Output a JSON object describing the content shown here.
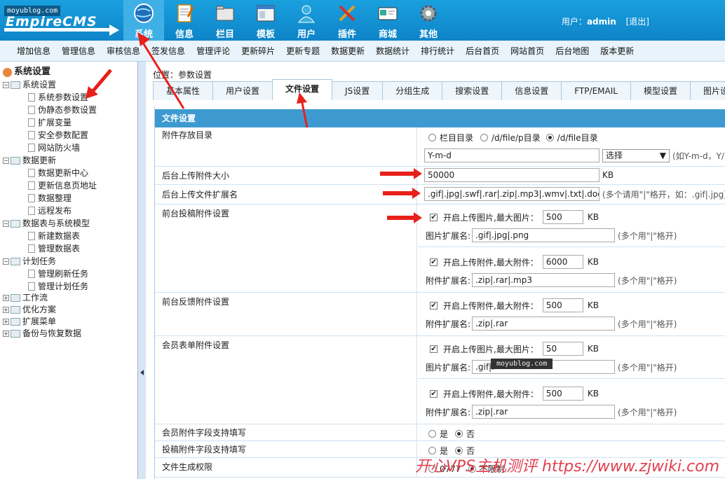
{
  "logo": {
    "site": "moyublog.com",
    "name": "EmpireCMS"
  },
  "nav": [
    {
      "label": "系统",
      "icon": "globe-icon",
      "active": true
    },
    {
      "label": "信息",
      "icon": "document-icon"
    },
    {
      "label": "栏目",
      "icon": "folder-icon"
    },
    {
      "label": "模板",
      "icon": "window-icon"
    },
    {
      "label": "用户",
      "icon": "user-icon"
    },
    {
      "label": "插件",
      "icon": "tools-icon"
    },
    {
      "label": "商城",
      "icon": "card-icon"
    },
    {
      "label": "其他",
      "icon": "gear-icon"
    }
  ],
  "user": {
    "prefix": "用户：",
    "name": "admin",
    "logout": "[退出]"
  },
  "subnav": [
    "增加信息",
    "管理信息",
    "审核信息",
    "签发信息",
    "管理评论",
    "更新碎片",
    "更新专题",
    "数据更新",
    "数据统计",
    "排行统计",
    "后台首页",
    "网站首页",
    "后台地图",
    "版本更新"
  ],
  "tree": {
    "root": "系统设置",
    "g1": "系统设置",
    "g1items": [
      "系统参数设置",
      "伪静态参数设置",
      "扩展变量",
      "安全参数配置",
      "网站防火墙"
    ],
    "g2": "数据更新",
    "g2items": [
      "数据更新中心",
      "更新信息页地址",
      "数据整理",
      "远程发布"
    ],
    "g3": "数据表与系统模型",
    "g3items": [
      "新建数据表",
      "管理数据表"
    ],
    "g4": "计划任务",
    "g4items": [
      "管理刷新任务",
      "管理计划任务"
    ],
    "others": [
      "工作流",
      "优化方案",
      "扩展菜单",
      "备份与恢复数据"
    ]
  },
  "location": "位置：参数设置",
  "tabs": [
    "基本属性",
    "用户设置",
    "文件设置",
    "JS设置",
    "分组生成",
    "搜索设置",
    "信息设置",
    "FTP/EMAIL",
    "模型设置",
    "图片设置"
  ],
  "panel": {
    "title": "文件设置",
    "dir": {
      "label": "附件存放目录",
      "opt1": "栏目目录",
      "opt2": "/d/file/p目录",
      "opt3": "/d/file目录",
      "format": "Y-m-d",
      "select": "选择",
      "hint": "(如Y-m-d，Y/m"
    },
    "size": {
      "label": "后台上传附件大小",
      "value": "50000",
      "unit": "KB"
    },
    "ext": {
      "label": "后台上传文件扩展名",
      "value": ".gif|.jpg|.swf|.rar|.zip|.mp3|.wmv|.txt|.doc|.",
      "hint": "(多个请用\"|\"格开，如：.gif|.jpg)"
    },
    "front": {
      "label": "前台投稿附件设置",
      "img_chk": "开启上传图片,最大图片：",
      "img_max": "500",
      "img_ext_label": "图片扩展名:",
      "img_ext": ".gif|.jpg|.png",
      "att_chk": "开启上传附件,最大附件：",
      "att_max": "6000",
      "att_ext_label": "附件扩展名:",
      "att_ext": ".zip|.rar|.mp3"
    },
    "feedback": {
      "label": "前台反馈附件设置",
      "att_chk": "开启上传附件,最大附件：",
      "att_max": "500",
      "att_ext_label": "附件扩展名:",
      "att_ext": ".zip|.rar"
    },
    "member": {
      "label": "会员表单附件设置",
      "img_chk": "开启上传图片,最大图片：",
      "img_max": "50",
      "img_ext_label": "图片扩展名:",
      "img_ext": ".gif|.",
      "att_chk": "开启上传附件,最大附件：",
      "att_max": "500",
      "att_ext_label": "附件扩展名:",
      "att_ext": ".zip|.rar"
    },
    "kb": "KB",
    "multi_hint": "(多个用\"|\"格开)",
    "memfield": {
      "label": "会员附件字段支持填写",
      "yes": "是",
      "no": "否"
    },
    "postfield": {
      "label": "投稿附件字段支持填写",
      "yes": "是",
      "no": "否"
    },
    "perm": {
      "label": "文件生成权限",
      "opt1": "0777",
      "opt2": "不限制"
    }
  },
  "watermarks": {
    "mid": "moyublog.com",
    "corner": "开心VPS主机测评 https://www.zjwiki.com"
  }
}
